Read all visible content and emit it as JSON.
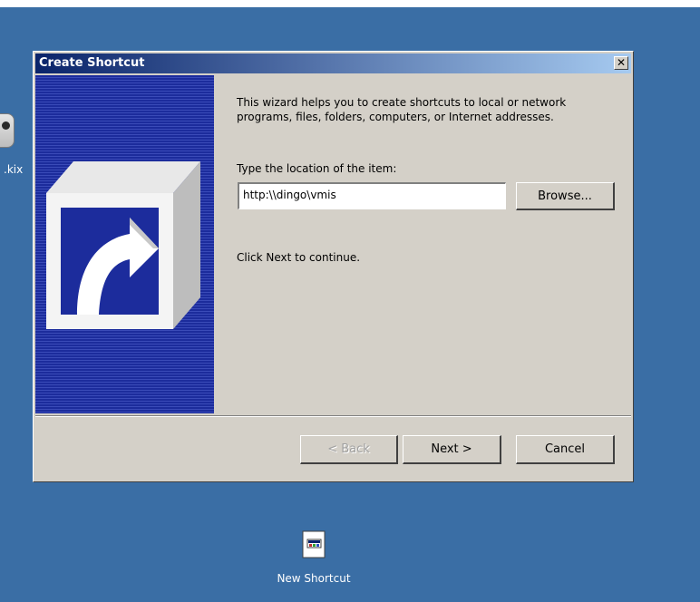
{
  "dialog": {
    "title": "Create Shortcut",
    "close_glyph": "✕",
    "intro": "This wizard helps you to create shortcuts to local or network programs, files, folders, computers, or Internet addresses.",
    "location_label": "Type the location of the item:",
    "location_value": "http:\\\\dingo\\vmis",
    "browse_label": "Browse...",
    "continue_text": "Click Next to continue.",
    "back_label": "< Back",
    "next_label": "Next >",
    "cancel_label": "Cancel"
  },
  "desktop": {
    "left_icon_label": ".kix",
    "shortcut_label": "New Shortcut"
  },
  "colors": {
    "desktop": "#3a6ea5",
    "dialog": "#d4d0c8",
    "titlebar_start": "#0a246a",
    "titlebar_end": "#a6caf0",
    "wizard_panel": "#1c2c9c"
  }
}
